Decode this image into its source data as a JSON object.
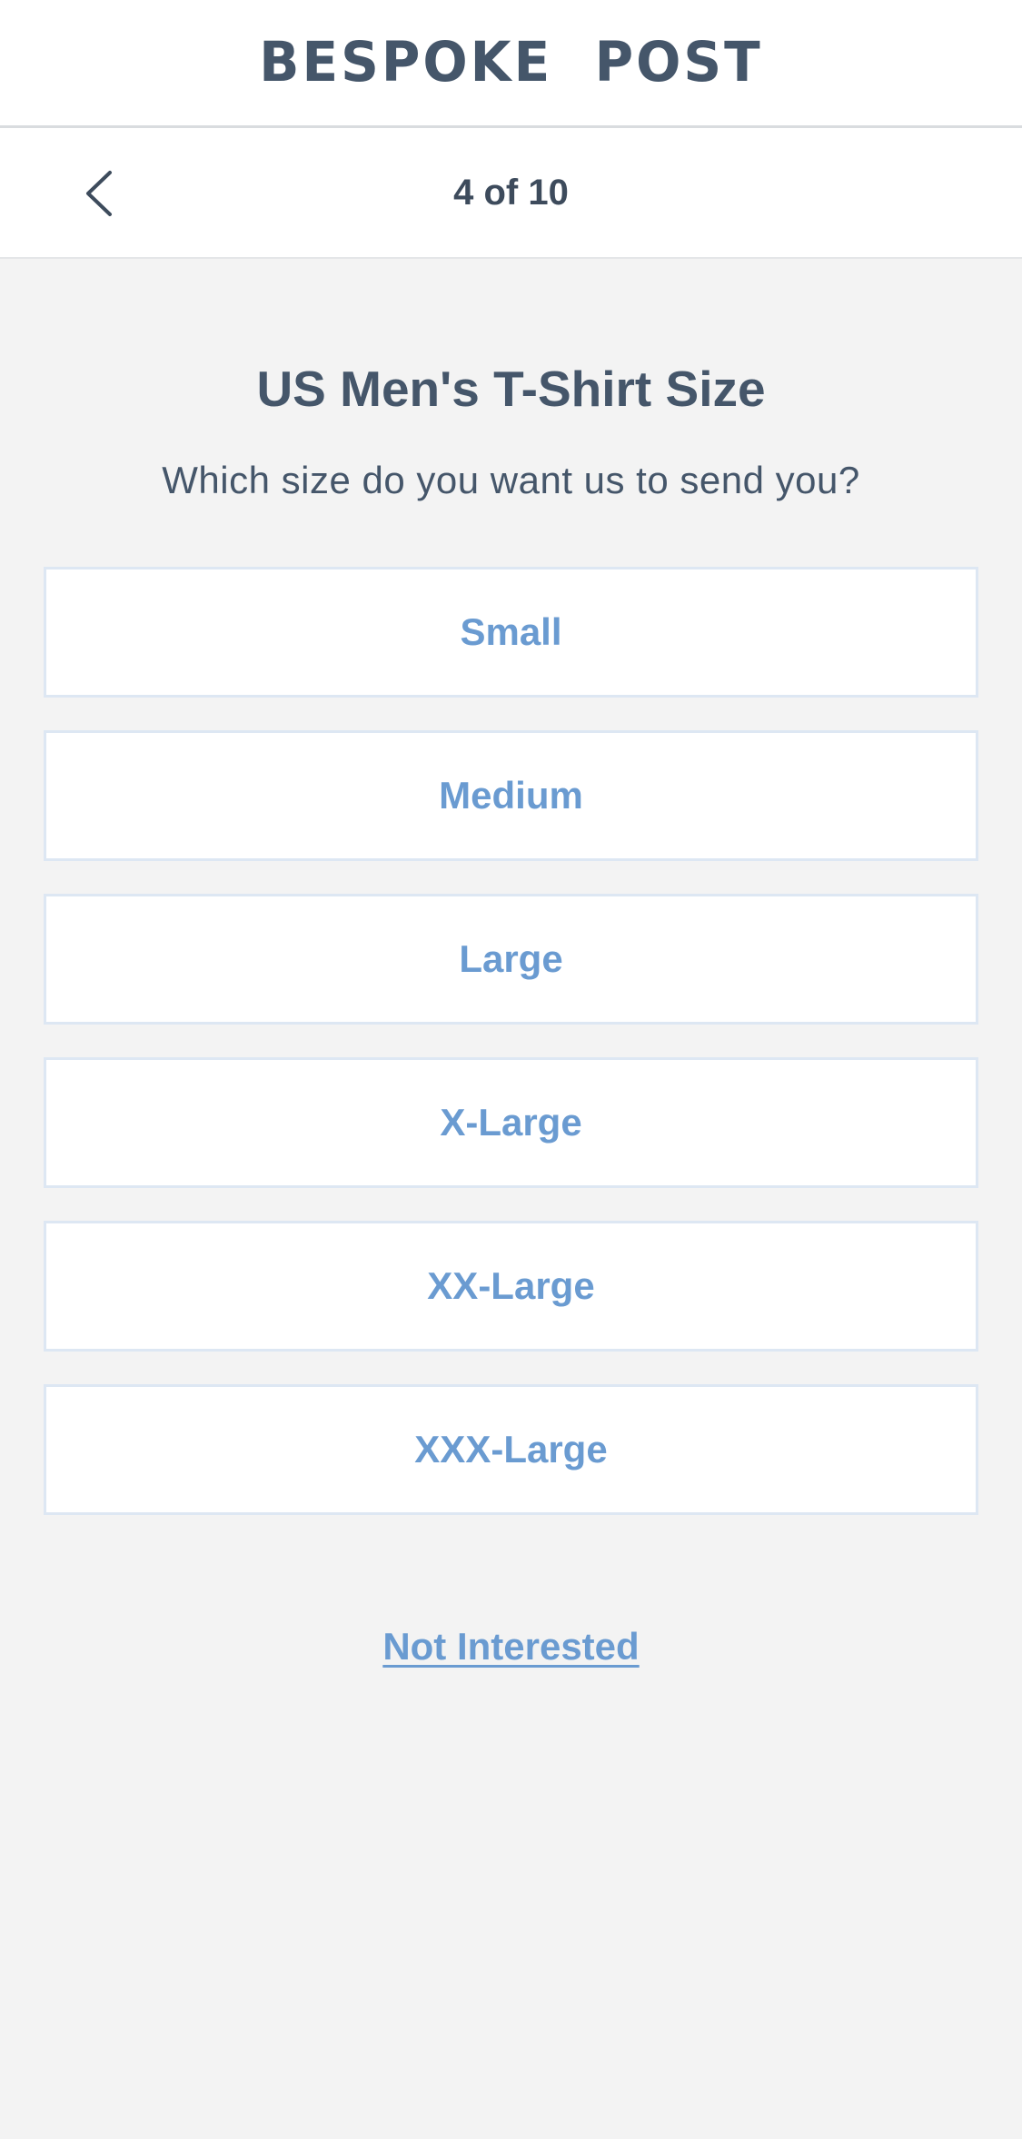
{
  "header": {
    "logo_text": "BESPOKE  POST"
  },
  "stepbar": {
    "back_icon": "chevron-left-icon",
    "step_label": "4 of 10"
  },
  "question": {
    "title": "US Men's T-Shirt Size",
    "subtitle": "Which size do you want us to send you?"
  },
  "options": [
    {
      "label": "Small"
    },
    {
      "label": "Medium"
    },
    {
      "label": "Large"
    },
    {
      "label": "X-Large"
    },
    {
      "label": "XX-Large"
    },
    {
      "label": "XXX-Large"
    }
  ],
  "footer": {
    "not_interested_label": "Not Interested"
  },
  "colors": {
    "brand_text": "#45566a",
    "accent": "#6a9bd1",
    "option_border": "#dde7f3",
    "background": "#f3f3f3"
  }
}
